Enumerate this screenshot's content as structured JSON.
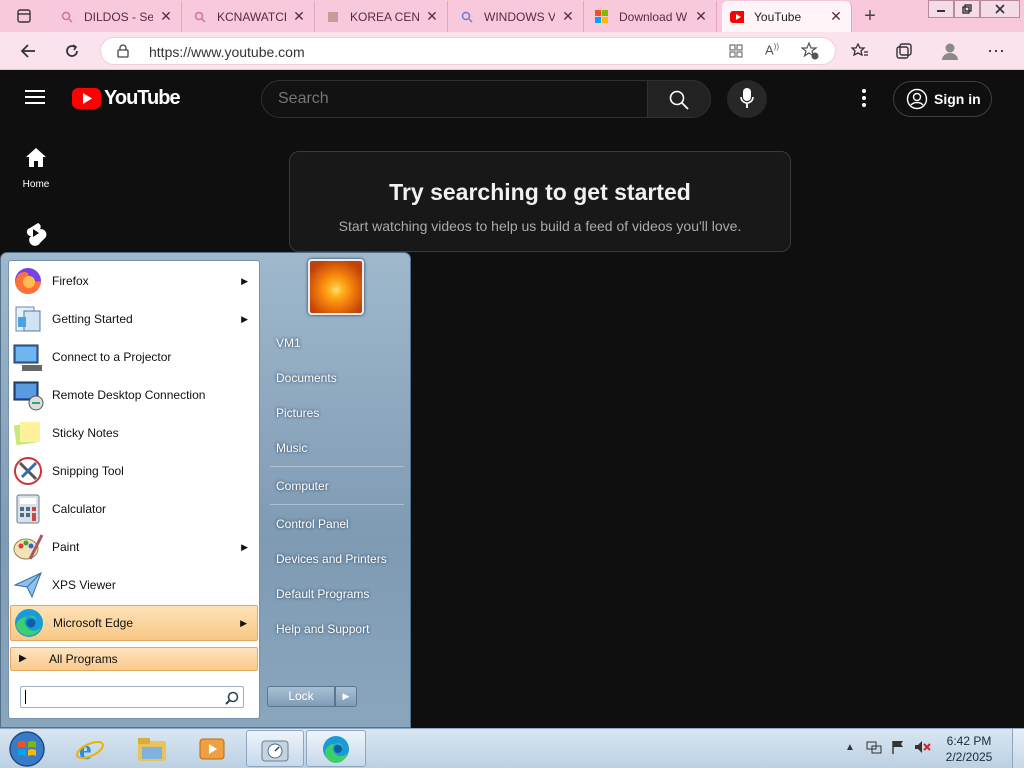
{
  "browser": {
    "tabs": [
      {
        "label": "DILDOS - Sea",
        "icon": "search-icon"
      },
      {
        "label": "KCNAWATCH",
        "icon": "search-icon"
      },
      {
        "label": "KOREA CENT",
        "icon": "site-favicon"
      },
      {
        "label": "WINDOWS V",
        "icon": "search-icon"
      },
      {
        "label": "Download W",
        "icon": "microsoft-logo"
      },
      {
        "label": "YouTube",
        "icon": "youtube-icon"
      }
    ],
    "url": "https://www.youtube.com"
  },
  "youtube": {
    "logo_text": "YouTube",
    "search_placeholder": "Search",
    "signin_label": "Sign in",
    "sidebar": [
      {
        "label": "Home"
      }
    ],
    "promo_title": "Try searching to get started",
    "promo_subtitle": "Start watching videos to help us build a feed of videos you'll love."
  },
  "start_menu": {
    "programs": [
      {
        "label": "Firefox",
        "has_submenu": true,
        "icon": "firefox-icon"
      },
      {
        "label": "Getting Started",
        "has_submenu": true,
        "icon": "getting-started-icon"
      },
      {
        "label": "Connect to a Projector",
        "has_submenu": false,
        "icon": "projector-icon"
      },
      {
        "label": "Remote Desktop Connection",
        "has_submenu": false,
        "icon": "remote-desktop-icon"
      },
      {
        "label": "Sticky Notes",
        "has_submenu": false,
        "icon": "sticky-notes-icon"
      },
      {
        "label": "Snipping Tool",
        "has_submenu": false,
        "icon": "snipping-tool-icon"
      },
      {
        "label": "Calculator",
        "has_submenu": false,
        "icon": "calculator-icon"
      },
      {
        "label": "Paint",
        "has_submenu": true,
        "icon": "paint-icon"
      },
      {
        "label": "XPS Viewer",
        "has_submenu": false,
        "icon": "xps-viewer-icon"
      },
      {
        "label": "Microsoft Edge",
        "has_submenu": true,
        "icon": "edge-icon"
      }
    ],
    "all_programs": "All Programs",
    "right_items": [
      "VM1",
      "Documents",
      "Pictures",
      "Music",
      "Computer",
      "Control Panel",
      "Devices and Printers",
      "Default Programs",
      "Help and Support"
    ],
    "lock_label": "Lock"
  },
  "taskbar": {
    "time": "6:42 PM",
    "date": "2/2/2025"
  }
}
